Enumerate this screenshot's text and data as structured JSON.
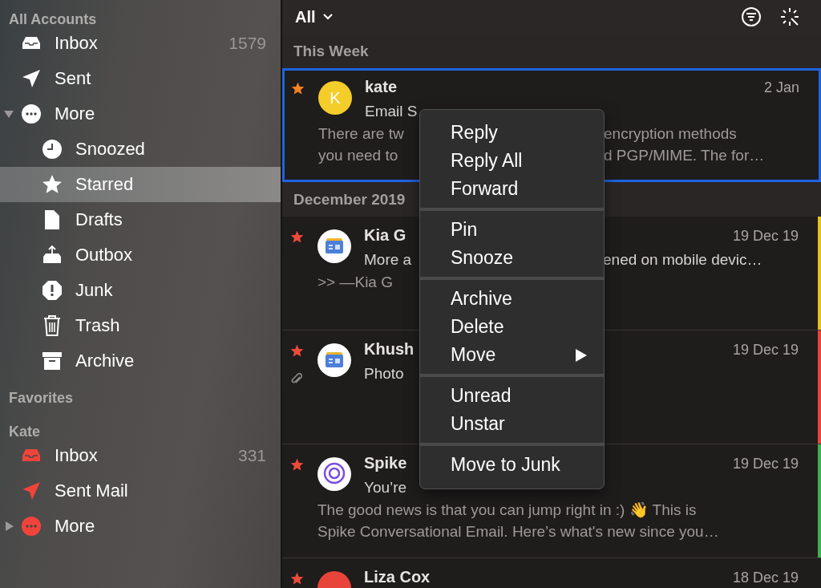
{
  "sidebar": {
    "sections": [
      {
        "title": "All Accounts",
        "color": "#ffffff",
        "items": [
          {
            "label": "Inbox",
            "kind": "inbox",
            "count": "1579",
            "selected": false
          },
          {
            "label": "Sent",
            "kind": "sent",
            "selected": false
          },
          {
            "label": "More",
            "kind": "more",
            "selected": false,
            "expanded": true,
            "children": [
              {
                "label": "Snoozed",
                "kind": "snoozed",
                "selected": false
              },
              {
                "label": "Starred",
                "kind": "starred",
                "selected": true
              },
              {
                "label": "Drafts",
                "kind": "drafts",
                "selected": false
              },
              {
                "label": "Outbox",
                "kind": "outbox",
                "selected": false
              },
              {
                "label": "Junk",
                "kind": "junk",
                "selected": false
              },
              {
                "label": "Trash",
                "kind": "trash",
                "selected": false
              },
              {
                "label": "Archive",
                "kind": "archive",
                "selected": false
              }
            ]
          }
        ]
      },
      {
        "title": "Favorites"
      },
      {
        "title": "Kate",
        "color": "#f0443a",
        "items": [
          {
            "label": "Inbox",
            "kind": "inbox",
            "count": "331",
            "selected": false
          },
          {
            "label": "Sent Mail",
            "kind": "sent",
            "selected": false
          },
          {
            "label": "More",
            "kind": "more",
            "selected": false,
            "expanded": false
          }
        ]
      }
    ]
  },
  "toolbar": {
    "filter": "All"
  },
  "groups": [
    {
      "title": "This Week",
      "emails": [
        {
          "sender": "kate",
          "date": "2 Jan",
          "starred": true,
          "attachment": false,
          "selected": true,
          "avatar": {
            "kind": "letter",
            "color": "#f5cd2a",
            "letter": "K"
          },
          "subject": {
            "left": "Email S"
          },
          "preview": [
            {
              "left": "There are tw",
              "right": "encryption methods"
            },
            {
              "left": "you need to",
              "right": "d PGP/MIME. The for…"
            }
          ]
        }
      ]
    },
    {
      "title": "December 2019",
      "emails": [
        {
          "sender": "Kia G",
          "date": "19 Dec 19",
          "starred": true,
          "attachment": false,
          "selected": false,
          "color": "#e8c21c",
          "avatar": {
            "kind": "news"
          },
          "subject": {
            "left": "More a",
            "right": "ened on mobile devic…"
          },
          "preview": [
            {
              "left": ">> —Kia G"
            }
          ]
        },
        {
          "sender": "Khush",
          "date": "19 Dec 19",
          "starred": true,
          "attachment": true,
          "selected": false,
          "color": "#e8443a",
          "avatar": {
            "kind": "news"
          },
          "subject": {
            "left": "Photo"
          }
        },
        {
          "sender": "Spike",
          "date": "19 Dec 19",
          "starred": true,
          "attachment": false,
          "selected": false,
          "color": "#3bb34a",
          "avatar": {
            "kind": "spike"
          },
          "subject": {
            "left": "You’re"
          },
          "preview": [
            {
              "full": "The good news is that you can jump right in :) 👋 This is"
            },
            {
              "full": "Spike Conversational Email. Here’s what's new since you…"
            }
          ]
        },
        {
          "sender": "Liza Cox",
          "date": "18 Dec 19",
          "starred": true,
          "attachment": false,
          "selected": false,
          "avatar": {
            "kind": "letter",
            "color": "#e8443a"
          }
        }
      ]
    }
  ],
  "context_menu": {
    "groups": [
      [
        {
          "label": "Reply"
        },
        {
          "label": "Reply All"
        },
        {
          "label": "Forward"
        }
      ],
      [
        {
          "label": "Pin"
        },
        {
          "label": "Snooze"
        }
      ],
      [
        {
          "label": "Archive"
        },
        {
          "label": "Delete"
        },
        {
          "label": "Move",
          "submenu": true
        }
      ],
      [
        {
          "label": "Unread"
        },
        {
          "label": "Unstar"
        }
      ],
      [
        {
          "label": "Move to Junk"
        }
      ]
    ]
  }
}
